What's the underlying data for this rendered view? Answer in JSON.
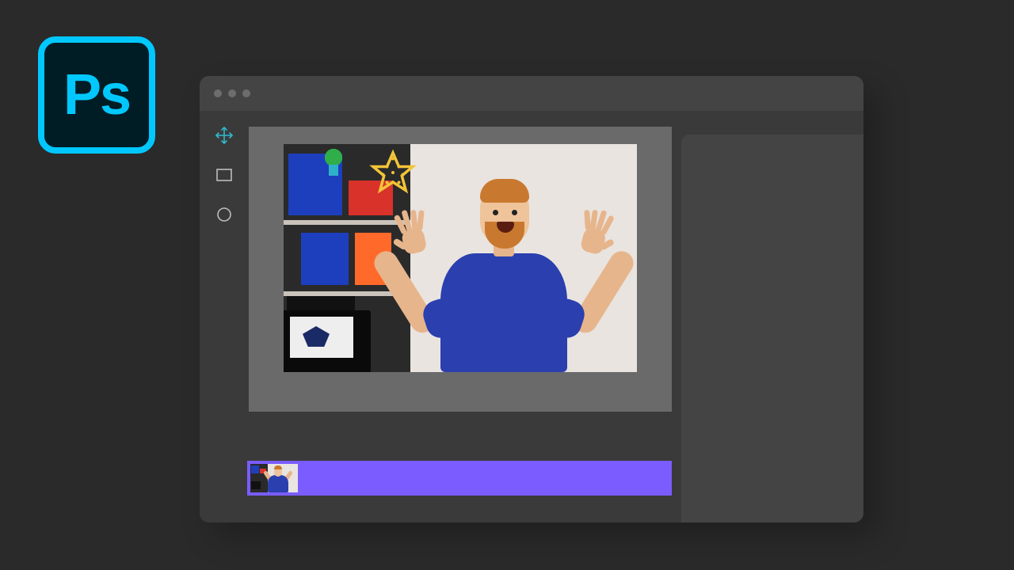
{
  "badge": {
    "label": "Ps"
  },
  "window": {
    "traffic_dots": 3
  },
  "tools": [
    {
      "name": "move-tool-icon",
      "active": true
    },
    {
      "name": "rectangle-tool-icon",
      "active": false
    },
    {
      "name": "ellipse-tool-icon",
      "active": false
    }
  ],
  "timeline": {
    "clip_color": "#7a5cff"
  },
  "colors": {
    "bg": "#2a2a2a",
    "window": "#3a3a3a",
    "panel": "#444444",
    "canvas": "#6a6a6a",
    "accent_cyan": "#00c8ff",
    "accent_purple": "#7a5cff"
  }
}
